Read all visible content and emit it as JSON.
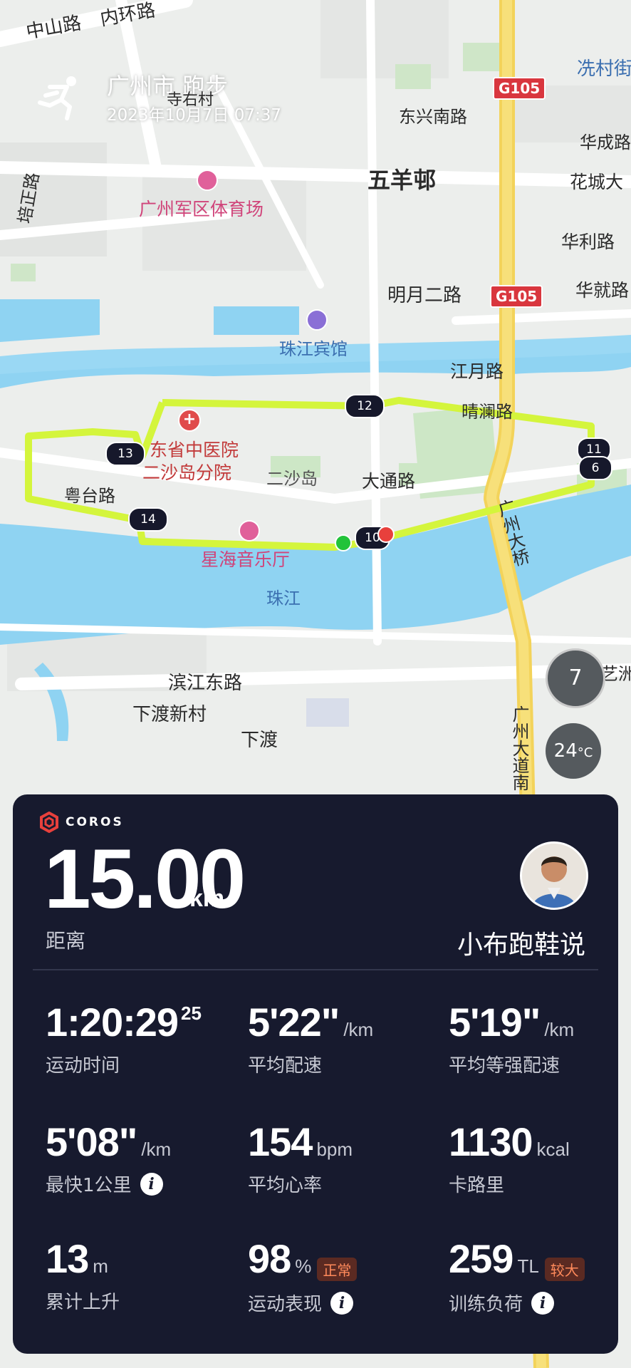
{
  "header": {
    "title": "广州市 跑步",
    "date": "2023年10月7日 07:37"
  },
  "map": {
    "labels": {
      "zhongshan_road": "中山路",
      "ring_road": "内环路",
      "siyou": "寺右村",
      "peizheng": "培正路",
      "stadium": "广州军区体育场",
      "dongxing": "东兴南路",
      "wuyangcun": "五羊邨",
      "xiancun": "冼村街",
      "huacheng_road": "华成路",
      "huacheng_ave": "花城大",
      "huali": "华利路",
      "huajiu": "华就路",
      "mingyue": "明月二路",
      "hotel": "珠江宾馆",
      "jiangyue": "江月路",
      "qinglan": "晴澜路",
      "hospital_1": "东省中医院",
      "hospital_2": "二沙岛分院",
      "ershadao": "二沙岛",
      "datong": "大通路",
      "guangzhou_bridge": "广州大桥",
      "yuetai": "粤台路",
      "concert_hall": "星海音乐厅",
      "pearl_river": "珠江",
      "binjiang": "滨江东路",
      "xiadu_village": "下渡新村",
      "xiadu": "下渡",
      "dadao_south": "广州大道南",
      "yizhou": "艺洲"
    },
    "highway_shields": [
      "G105",
      "G105"
    ],
    "km_markers": [
      "12",
      "13",
      "14",
      "11",
      "6",
      "10"
    ],
    "compass_value": "7",
    "temperature": "24",
    "temperature_unit": "°C",
    "route_color": "#d4f53c",
    "start_color": "#22c33a",
    "end_color": "#e8403c"
  },
  "card": {
    "brand": "COROS",
    "distance": "15.00",
    "distance_unit": "km",
    "distance_label": "距离",
    "username": "小布跑鞋说",
    "stats": [
      {
        "value": "1:20:29",
        "sup": "25",
        "unit": "",
        "label": "运动时间"
      },
      {
        "value": "5'22\"",
        "unit": "/km",
        "label": "平均配速"
      },
      {
        "value": "5'19\"",
        "unit": "/km",
        "label": "平均等强配速"
      },
      {
        "value": "5'08\"",
        "unit": "/km",
        "label": "最快1公里"
      },
      {
        "value": "154",
        "unit": "bpm",
        "label": "平均心率"
      },
      {
        "value": "1130",
        "unit": "kcal",
        "label": "卡路里"
      },
      {
        "value": "13",
        "unit": "m",
        "label": "累计上升"
      },
      {
        "value": "98",
        "unit": "%",
        "label": "运动表现",
        "badge": "正常"
      },
      {
        "value": "259",
        "unit": "TL",
        "label": "训练负荷",
        "badge": "较大"
      }
    ],
    "info_glyph": "i"
  }
}
